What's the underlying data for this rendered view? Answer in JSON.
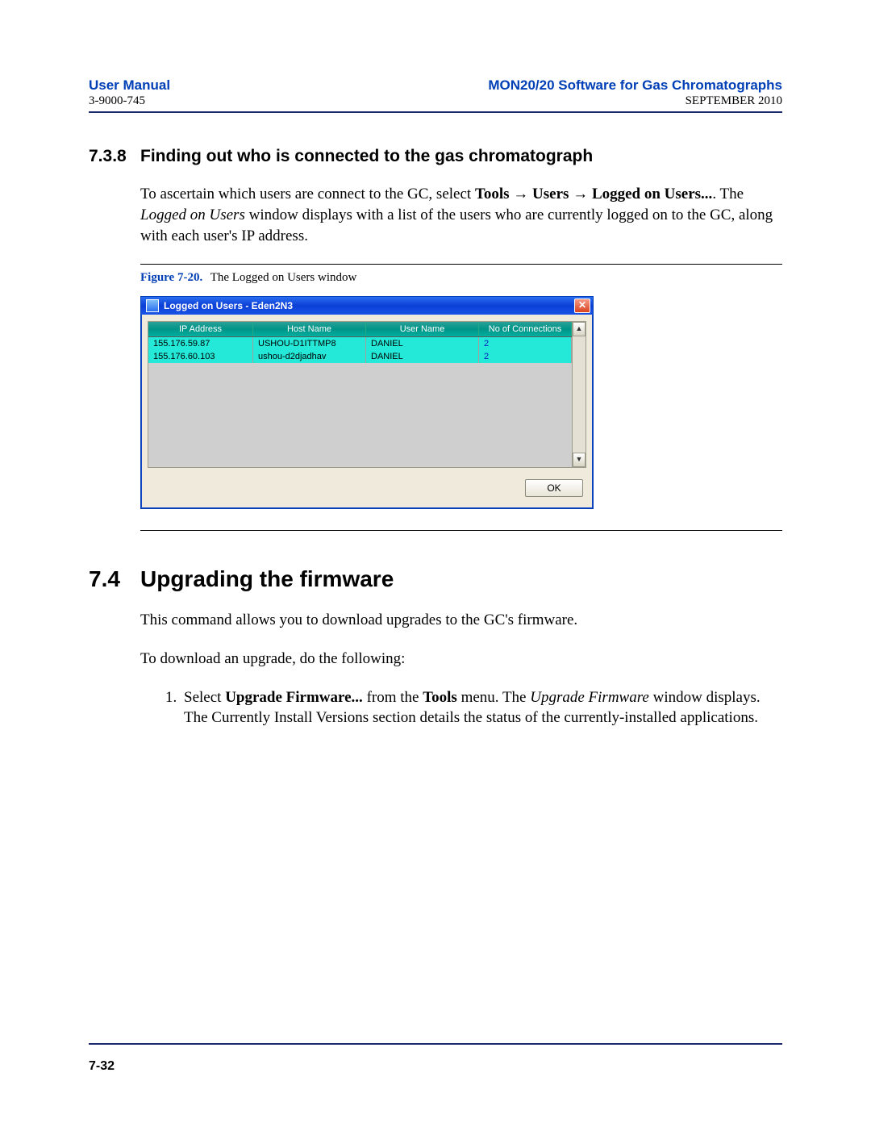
{
  "header": {
    "left_title": "User Manual",
    "left_sub": "3-9000-745",
    "right_title": "MON20/20 Software for Gas Chromatographs",
    "right_sub": "SEPTEMBER 2010"
  },
  "section_738": {
    "number": "7.3.8",
    "title": "Finding out who is connected to the gas chromatograph",
    "para_pre": "To ascertain which users are connect to the GC, select ",
    "tools": "Tools",
    "arrow": " → ",
    "users": "Users",
    "logged_on": "Logged on Users...",
    "para_mid": ".  The ",
    "window_name": "Logged on Users",
    "para_post": " window displays with a list of the users who are currently logged on to the GC, along with each user's IP address."
  },
  "figure": {
    "label": "Figure 7-20.",
    "caption": "The Logged on Users window",
    "window_title": "Logged on Users - Eden2N3",
    "close_glyph": "✕",
    "scroll_up": "▲",
    "scroll_down": "▼",
    "columns": {
      "ip": "IP Address",
      "host": "Host Name",
      "user": "User Name",
      "conn": "No of Connections"
    },
    "rows": [
      {
        "ip": "155.176.59.87",
        "host": "USHOU-D1ITTMP8",
        "user": "DANIEL",
        "conn": "2"
      },
      {
        "ip": "155.176.60.103",
        "host": "ushou-d2djadhav",
        "user": "DANIEL",
        "conn": "2"
      }
    ],
    "ok_label": "OK"
  },
  "section_74": {
    "number": "7.4",
    "title": "Upgrading the firmware",
    "para1": "This command allows you to download upgrades to the GC's firmware.",
    "para2": "To download an upgrade, do the following:",
    "step1_pre": "Select ",
    "step1_b1": "Upgrade Firmware...",
    "step1_mid1": " from the ",
    "step1_b2": "Tools",
    "step1_mid2": " menu.  The ",
    "step1_it": "Upgrade Firmware",
    "step1_post": " window displays.  The Currently Install Versions section details the status of the currently-installed applications."
  },
  "footer": {
    "page": "7-32"
  }
}
